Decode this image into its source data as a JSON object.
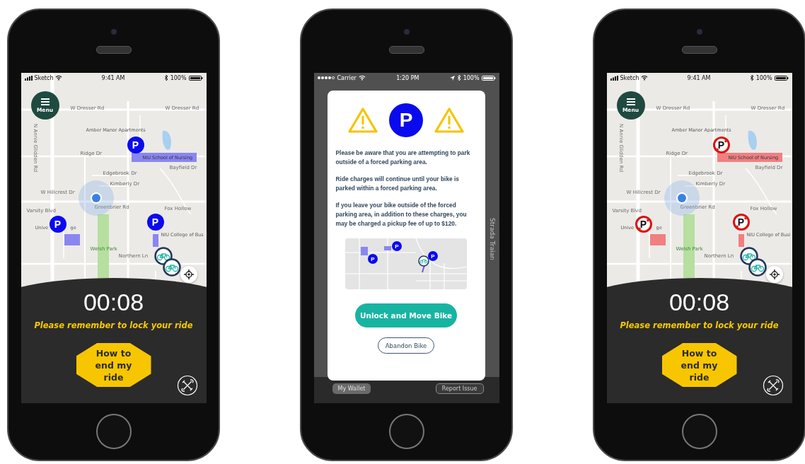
{
  "phones": [
    {
      "kind": "ride",
      "status_bar": {
        "carrier": "Sketch",
        "time": "9:41 AM",
        "battery": "100%"
      },
      "menu_button": "Menu",
      "map": {
        "zones": [
          {
            "kind": "parking"
          },
          {
            "kind": "parking"
          },
          {
            "kind": "parking"
          }
        ],
        "markers": [
          {
            "label": "P",
            "kind": "parking"
          },
          {
            "label": "P",
            "kind": "parking"
          },
          {
            "label": "P",
            "kind": "parking"
          }
        ],
        "labels": [
          {
            "text": "W Dresser Rd",
            "kind": "street"
          },
          {
            "text": "W Dresser Rd",
            "kind": "street"
          },
          {
            "text": "N Annie Glidden Rd",
            "kind": "vertical"
          },
          {
            "text": "Amber Manor Apartments",
            "kind": "poi"
          },
          {
            "text": "Ridge Dr",
            "kind": "street"
          },
          {
            "text": "NIU School of Nursing",
            "kind": "poi"
          },
          {
            "text": "Bayfield Dr",
            "kind": "street"
          },
          {
            "text": "Edgebrook Dr",
            "kind": "street"
          },
          {
            "text": "Kimberly Dr",
            "kind": "street"
          },
          {
            "text": "W Hillcrest Dr",
            "kind": "street"
          },
          {
            "text": "Greenbrier Rd",
            "kind": "street"
          },
          {
            "text": "Fox Hollow",
            "kind": "street"
          },
          {
            "text": "Varsity Blvd",
            "kind": "street"
          },
          {
            "text": "NIU College of Bus",
            "kind": "poi"
          },
          {
            "text": "Welsh Park",
            "kind": "park"
          },
          {
            "text": "Northern Ln",
            "kind": "street"
          },
          {
            "text": "Unive",
            "kind": "poi"
          },
          {
            "text": "ge",
            "kind": "poi"
          }
        ]
      },
      "ride_panel": {
        "timer": "00:08",
        "reminder": "Please remember to lock your ride",
        "end_button": "How to end my ride"
      }
    },
    {
      "kind": "alert",
      "status_bar": {
        "carrier": "Carrier",
        "time": "1:20 PM",
        "battery": "100%"
      },
      "background": {
        "labels": [
          "Strada Traian"
        ],
        "buttons": [
          "My Wallet",
          "Report Issue"
        ]
      },
      "dialog": {
        "badge": "P",
        "paragraphs": [
          "Please be aware that you are attempting to park outside of a forced parking area.",
          "Ride charges will continue until your bike is parked within a forced parking area.",
          "If you leave your bike outside of the forced parking area, in addition to these charges, you may be charged a pickup fee of up to $120."
        ],
        "map_markers": [
          "P",
          "P",
          "P"
        ],
        "primary_button": "Unlock and Move Bike",
        "secondary_button": "Abandon Bike"
      }
    },
    {
      "kind": "ride",
      "status_bar": {
        "carrier": "Sketch",
        "time": "9:41 AM",
        "battery": "100%"
      },
      "menu_button": "Menu",
      "map": {
        "zones": [
          {
            "kind": "no_parking"
          },
          {
            "kind": "no_parking"
          },
          {
            "kind": "no_parking"
          }
        ],
        "markers": [
          {
            "label": "P",
            "kind": "no_parking"
          },
          {
            "label": "P",
            "kind": "no_parking"
          },
          {
            "label": "P",
            "kind": "no_parking"
          }
        ],
        "labels": [
          {
            "text": "W Dresser Rd",
            "kind": "street"
          },
          {
            "text": "W Dresser Rd",
            "kind": "street"
          },
          {
            "text": "N Annie Glidden Rd",
            "kind": "vertical"
          },
          {
            "text": "Amber Manor Apartments",
            "kind": "poi"
          },
          {
            "text": "Ridge Dr",
            "kind": "street"
          },
          {
            "text": "NIU School of Nursing",
            "kind": "poi"
          },
          {
            "text": "Bayfield Dr",
            "kind": "street"
          },
          {
            "text": "Edgebrook Dr",
            "kind": "street"
          },
          {
            "text": "Kimberly Dr",
            "kind": "street"
          },
          {
            "text": "W Hillcrest Dr",
            "kind": "street"
          },
          {
            "text": "Greenbrier Rd",
            "kind": "street"
          },
          {
            "text": "Fox Hollow",
            "kind": "street"
          },
          {
            "text": "Varsity Blvd",
            "kind": "street"
          },
          {
            "text": "NIU College of Busi",
            "kind": "poi"
          },
          {
            "text": "Welsh Park",
            "kind": "park"
          },
          {
            "text": "Northern Ln",
            "kind": "street"
          },
          {
            "text": "Unive",
            "kind": "poi"
          },
          {
            "text": "ge",
            "kind": "poi"
          }
        ]
      },
      "ride_panel": {
        "timer": "00:08",
        "reminder": "Please remember to lock your ride",
        "end_button": "How to end my ride"
      }
    }
  ]
}
